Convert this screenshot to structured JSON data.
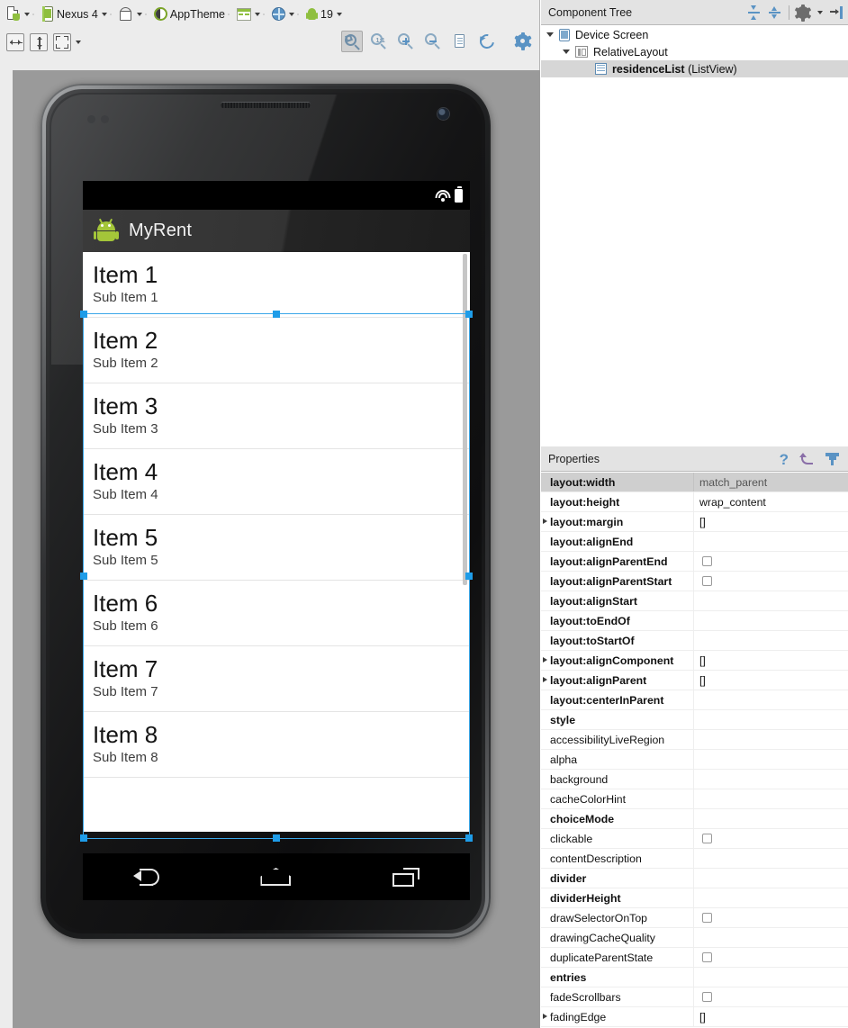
{
  "toolbar": {
    "row1": [
      {
        "name": "device-config-dropdown",
        "icon": "device-icon",
        "label": ""
      },
      {
        "name": "device-selector",
        "icon": "nexus-phone-icon",
        "label": "Nexus 4"
      },
      {
        "name": "orientation-selector",
        "icon": "orientation-icon",
        "label": ""
      },
      {
        "name": "theme-selector",
        "icon": "theme-circle-icon",
        "label": "AppTheme"
      },
      {
        "name": "activity-selector",
        "icon": "layout-icon",
        "label": ""
      },
      {
        "name": "locale-selector",
        "icon": "globe-icon",
        "label": ""
      },
      {
        "name": "api-level-selector",
        "icon": "android-icon",
        "label": "19"
      }
    ],
    "row2_left": [
      {
        "name": "distribute-horizontal-button",
        "icon": "arrows-horizontal-icon"
      },
      {
        "name": "distribute-vertical-button",
        "icon": "arrows-vertical-icon"
      },
      {
        "name": "expand-layout-button",
        "icon": "expand-corners-icon"
      }
    ],
    "row2_right": [
      {
        "name": "zoom-to-fit-button",
        "icon": "zoom-fit-icon",
        "active": true
      },
      {
        "name": "zoom-actual-size-button",
        "icon": "zoom-1to1-icon",
        "label": "1:1"
      },
      {
        "name": "zoom-in-button",
        "icon": "zoom-in-icon"
      },
      {
        "name": "zoom-out-button",
        "icon": "zoom-out-icon"
      },
      {
        "name": "show-xml-button",
        "icon": "document-icon"
      },
      {
        "name": "refresh-render-button",
        "icon": "refresh-icon"
      },
      {
        "name": "render-settings-button",
        "icon": "gear-icon"
      }
    ]
  },
  "preview": {
    "app_title": "MyRent",
    "status_icons": [
      "wifi-icon",
      "battery-icon"
    ],
    "nav_icons": [
      "back-icon",
      "home-icon",
      "recents-icon"
    ],
    "list_items": [
      {
        "title": "Item 1",
        "subtitle": "Sub Item 1"
      },
      {
        "title": "Item 2",
        "subtitle": "Sub Item 2"
      },
      {
        "title": "Item 3",
        "subtitle": "Sub Item 3"
      },
      {
        "title": "Item 4",
        "subtitle": "Sub Item 4"
      },
      {
        "title": "Item 5",
        "subtitle": "Sub Item 5"
      },
      {
        "title": "Item 6",
        "subtitle": "Sub Item 6"
      },
      {
        "title": "Item 7",
        "subtitle": "Sub Item 7"
      },
      {
        "title": "Item 8",
        "subtitle": "Sub Item 8"
      }
    ]
  },
  "component_tree": {
    "title": "Component Tree",
    "header_icons": [
      "expand-all-icon",
      "collapse-all-icon",
      "settings-gear-icon",
      "hide-panel-icon"
    ],
    "nodes": [
      {
        "label": "Device Screen",
        "type": "",
        "icon": "device-screen-icon",
        "depth": 0,
        "expanded": true,
        "selected": false
      },
      {
        "label": "RelativeLayout",
        "type": "",
        "icon": "relative-layout-icon",
        "depth": 1,
        "expanded": true,
        "selected": false
      },
      {
        "label": "residenceList",
        "type": " (ListView)",
        "icon": "listview-icon",
        "depth": 2,
        "expanded": null,
        "selected": true
      }
    ]
  },
  "properties": {
    "title": "Properties",
    "header_icons": [
      "help-icon",
      "undo-icon",
      "filter-icon"
    ],
    "rows": [
      {
        "name": "layout:width",
        "value": "match_parent",
        "bold": true,
        "expandable": false,
        "checkbox": false,
        "selected": true
      },
      {
        "name": "layout:height",
        "value": "wrap_content",
        "bold": true,
        "expandable": false,
        "checkbox": false,
        "selected": false
      },
      {
        "name": "layout:margin",
        "value": "[]",
        "bold": true,
        "expandable": true,
        "checkbox": false,
        "selected": false
      },
      {
        "name": "layout:alignEnd",
        "value": "",
        "bold": true,
        "expandable": false,
        "checkbox": false,
        "selected": false
      },
      {
        "name": "layout:alignParentEnd",
        "value": "",
        "bold": true,
        "expandable": false,
        "checkbox": true,
        "selected": false
      },
      {
        "name": "layout:alignParentStart",
        "value": "",
        "bold": true,
        "expandable": false,
        "checkbox": true,
        "selected": false
      },
      {
        "name": "layout:alignStart",
        "value": "",
        "bold": true,
        "expandable": false,
        "checkbox": false,
        "selected": false
      },
      {
        "name": "layout:toEndOf",
        "value": "",
        "bold": true,
        "expandable": false,
        "checkbox": false,
        "selected": false
      },
      {
        "name": "layout:toStartOf",
        "value": "",
        "bold": true,
        "expandable": false,
        "checkbox": false,
        "selected": false
      },
      {
        "name": "layout:alignComponent",
        "value": "[]",
        "bold": true,
        "expandable": true,
        "checkbox": false,
        "selected": false
      },
      {
        "name": "layout:alignParent",
        "value": "[]",
        "bold": true,
        "expandable": true,
        "checkbox": false,
        "selected": false
      },
      {
        "name": "layout:centerInParent",
        "value": "",
        "bold": true,
        "expandable": false,
        "checkbox": false,
        "selected": false
      },
      {
        "name": "style",
        "value": "",
        "bold": true,
        "expandable": false,
        "checkbox": false,
        "selected": false
      },
      {
        "name": "accessibilityLiveRegion",
        "value": "",
        "bold": false,
        "expandable": false,
        "checkbox": false,
        "selected": false
      },
      {
        "name": "alpha",
        "value": "",
        "bold": false,
        "expandable": false,
        "checkbox": false,
        "selected": false
      },
      {
        "name": "background",
        "value": "",
        "bold": false,
        "expandable": false,
        "checkbox": false,
        "selected": false
      },
      {
        "name": "cacheColorHint",
        "value": "",
        "bold": false,
        "expandable": false,
        "checkbox": false,
        "selected": false
      },
      {
        "name": "choiceMode",
        "value": "",
        "bold": true,
        "expandable": false,
        "checkbox": false,
        "selected": false
      },
      {
        "name": "clickable",
        "value": "",
        "bold": false,
        "expandable": false,
        "checkbox": true,
        "selected": false
      },
      {
        "name": "contentDescription",
        "value": "",
        "bold": false,
        "expandable": false,
        "checkbox": false,
        "selected": false
      },
      {
        "name": "divider",
        "value": "",
        "bold": true,
        "expandable": false,
        "checkbox": false,
        "selected": false
      },
      {
        "name": "dividerHeight",
        "value": "",
        "bold": true,
        "expandable": false,
        "checkbox": false,
        "selected": false
      },
      {
        "name": "drawSelectorOnTop",
        "value": "",
        "bold": false,
        "expandable": false,
        "checkbox": true,
        "selected": false
      },
      {
        "name": "drawingCacheQuality",
        "value": "",
        "bold": false,
        "expandable": false,
        "checkbox": false,
        "selected": false
      },
      {
        "name": "duplicateParentState",
        "value": "",
        "bold": false,
        "expandable": false,
        "checkbox": true,
        "selected": false
      },
      {
        "name": "entries",
        "value": "",
        "bold": true,
        "expandable": false,
        "checkbox": false,
        "selected": false
      },
      {
        "name": "fadeScrollbars",
        "value": "",
        "bold": false,
        "expandable": false,
        "checkbox": true,
        "selected": false
      },
      {
        "name": "fadingEdge",
        "value": "[]",
        "bold": false,
        "expandable": true,
        "checkbox": false,
        "selected": false
      }
    ]
  },
  "colors": {
    "accent_blue": "#5a93c4",
    "selection_blue": "#1e9ce8",
    "android_green": "#a4c639",
    "panel_header": "#e3e3e3",
    "canvas_bg": "#9a9a9a"
  }
}
